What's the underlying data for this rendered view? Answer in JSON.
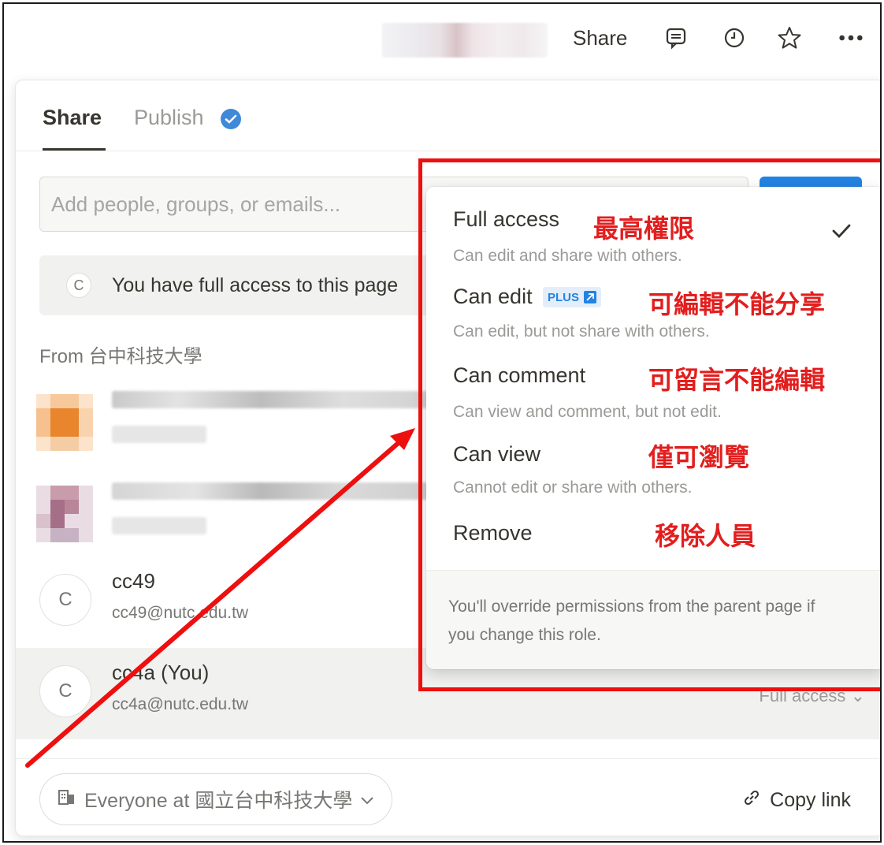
{
  "topbar": {
    "share_label": "Share",
    "icons": [
      "comment-icon",
      "history-clock-icon",
      "star-icon",
      "more-dots-icon"
    ]
  },
  "dialog": {
    "tabs": [
      {
        "label": "Share",
        "active": true
      },
      {
        "label": "Publish",
        "active": false
      }
    ],
    "input_placeholder": "Add people, groups, or emails...",
    "banner": {
      "avatar": "C",
      "text": "You have full access to this page"
    },
    "from_label": "From 台中科技大學",
    "people": [
      {
        "avatar": "C",
        "name": "cc49",
        "email": "cc49@nutc.edu.tw"
      },
      {
        "avatar": "C",
        "name": "cc4a (You)",
        "email": "cc4a@nutc.edu.tw",
        "role": "Full access"
      }
    ],
    "footer": {
      "everyone_label": "Everyone at 國立台中科技大學",
      "copy_link_label": "Copy link"
    }
  },
  "menu": {
    "items": [
      {
        "title": "Full access",
        "desc": "Can edit and share with others.",
        "annotation": "最高權限",
        "selected": true
      },
      {
        "title": "Can edit",
        "badge": "PLUS",
        "desc": "Can edit, but not share with others.",
        "annotation": "可編輯不能分享"
      },
      {
        "title": "Can comment",
        "desc": "Can view and comment, but not edit.",
        "annotation": "可留言不能編輯"
      },
      {
        "title": "Can view",
        "desc": "Cannot edit or share with others.",
        "annotation": "僅可瀏覽"
      },
      {
        "title": "Remove",
        "annotation": "移除人員"
      }
    ],
    "footer_note": "You'll override permissions from the parent page if you change this role."
  },
  "colors": {
    "annotation_red": "#e21e1e",
    "accent_blue": "#2383e2",
    "text_primary": "#37352f",
    "text_secondary": "#9b9a97"
  }
}
